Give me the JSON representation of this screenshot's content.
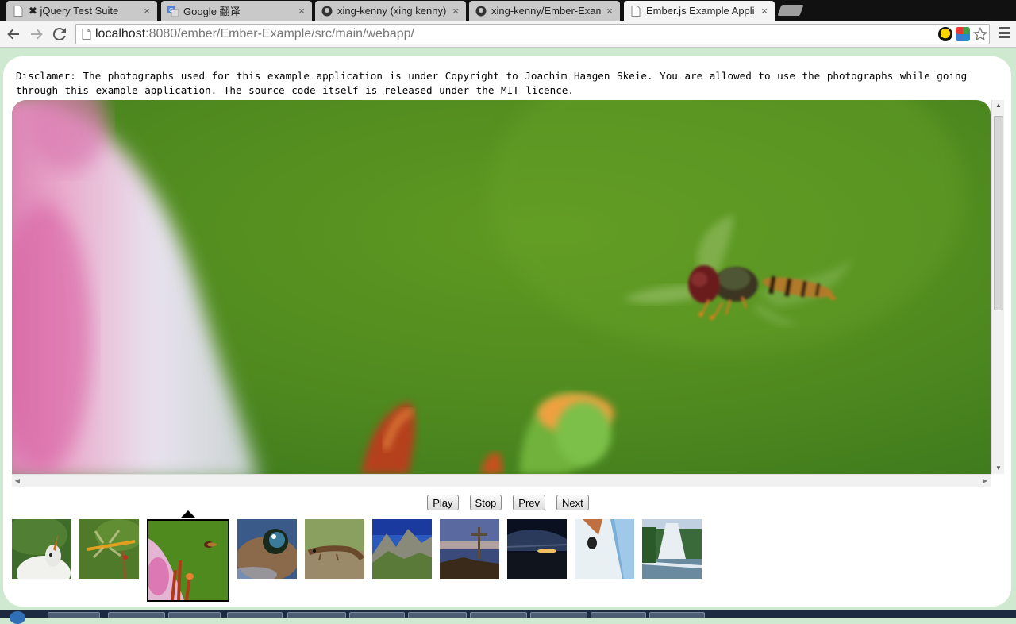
{
  "browser": {
    "tabs": [
      {
        "title": "✖ jQuery Test Suite",
        "icon": "page-icon",
        "active": false
      },
      {
        "title": "Google 翻译",
        "icon": "google-translate-icon",
        "active": false
      },
      {
        "title": "xing-kenny (xing kenny)",
        "icon": "github-icon",
        "active": false
      },
      {
        "title": "xing-kenny/Ember-Exam",
        "icon": "github-icon",
        "active": false
      },
      {
        "title": "Ember.js Example Appli",
        "icon": "page-icon",
        "active": true
      }
    ],
    "close_glyph": "×",
    "url_host": "localhost",
    "url_rest": ":8080/ember/Ember-Example/src/main/webapp/"
  },
  "page": {
    "disclaimer": "Disclamer: The photographs used for this example application is under Copyright to Joachim Haagen Skeie. You are allowed to use the photographs while going through this example application. The source code itself is released under the MIT licence."
  },
  "controls": {
    "play": "Play",
    "stop": "Stop",
    "prev": "Prev",
    "next": "Next"
  },
  "thumbnails": {
    "selected_index": 2,
    "items": [
      {
        "subject": "bird"
      },
      {
        "subject": "dragonfly"
      },
      {
        "subject": "hoverfly-lily"
      },
      {
        "subject": "frog-eye"
      },
      {
        "subject": "lizard"
      },
      {
        "subject": "mountains"
      },
      {
        "subject": "summit-cross"
      },
      {
        "subject": "sunset"
      },
      {
        "subject": "goat"
      },
      {
        "subject": "waterfall"
      }
    ]
  },
  "colors": {
    "page_background": "#cfe8d0",
    "photo_green": "#5a8f22"
  }
}
